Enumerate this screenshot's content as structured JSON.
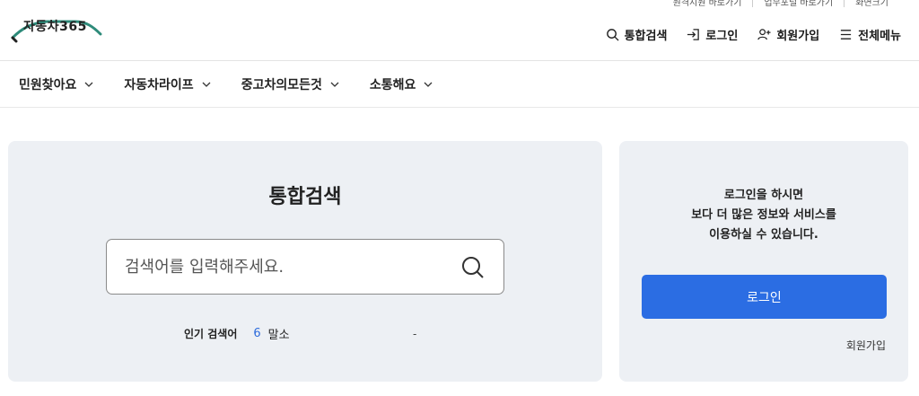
{
  "utility_links": [
    "원격지원 바로가기",
    "업무포털 바로가기",
    "화면크기"
  ],
  "logo": {
    "text": "자동차365"
  },
  "top_nav": {
    "search": "통합검색",
    "login": "로그인",
    "signup": "회원가입",
    "all_menu": "전체메뉴"
  },
  "gnb": [
    {
      "label": "민원찾아요"
    },
    {
      "label": "자동차라이프"
    },
    {
      "label": "중고차의모든것"
    },
    {
      "label": "소통해요"
    }
  ],
  "search_panel": {
    "title": "통합검색",
    "placeholder": "검색어를 입력해주세요.",
    "popular_label": "인기 검색어",
    "popular_rank": "6",
    "popular_word": "말소",
    "popular_dash": "-"
  },
  "login_panel": {
    "line1": "로그인을 하시면",
    "line2": "보다 더 많은 정보와 서비스를",
    "line3": "이용하실 수 있습니다.",
    "login_button": "로그인",
    "signup_link": "회원가입"
  },
  "colors": {
    "primary": "#2b6de3",
    "panel_bg": "#edf0f4",
    "logo_green": "#2e8b7a",
    "rank_blue": "#2d6bdb"
  }
}
